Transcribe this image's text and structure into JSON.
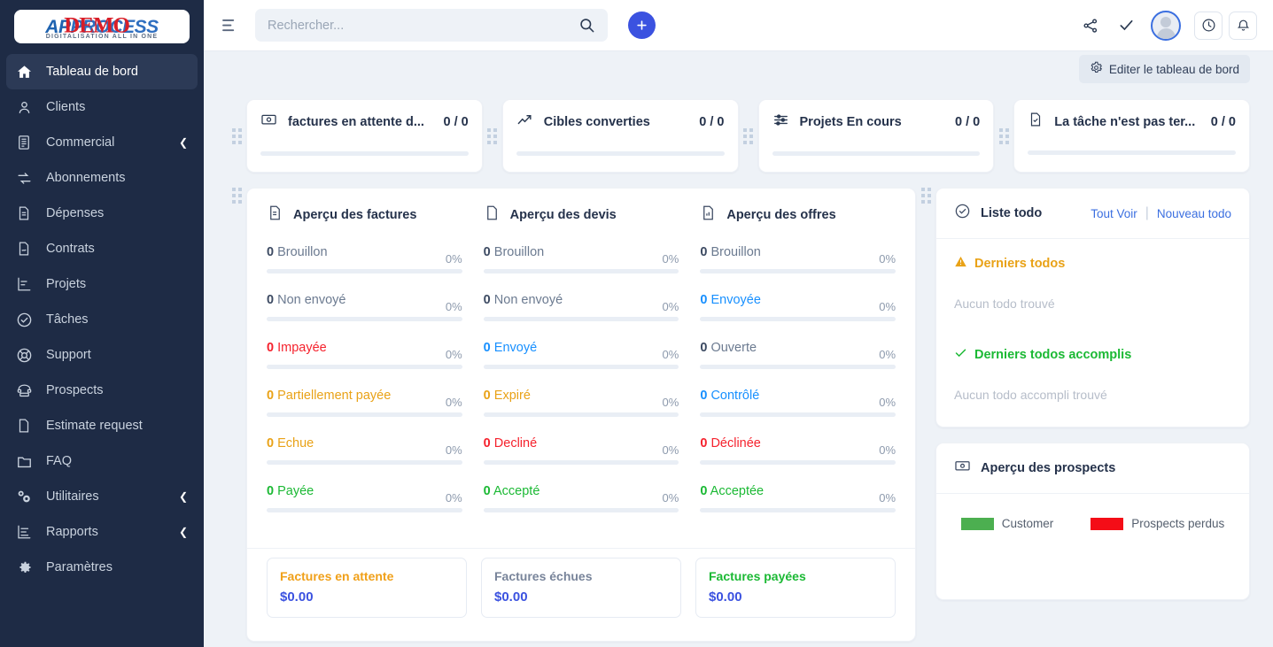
{
  "brand": {
    "logo_ap": "AP",
    "logo_process": "PROCESS",
    "logo_tagline": "DIGITALISATION ALL IN ONE",
    "logo_demo": "DEMO",
    "accent_blue": "#3b52e0",
    "navy": "#1e2b45"
  },
  "sidebar": {
    "items": [
      {
        "label": "Tableau de bord",
        "icon": "home-icon",
        "active": true,
        "caret": false
      },
      {
        "label": "Clients",
        "icon": "user-icon",
        "active": false,
        "caret": false
      },
      {
        "label": "Commercial",
        "icon": "receipt-icon",
        "active": false,
        "caret": true
      },
      {
        "label": "Abonnements",
        "icon": "refresh-icon",
        "active": false,
        "caret": false
      },
      {
        "label": "Dépenses",
        "icon": "document-icon",
        "active": false,
        "caret": false
      },
      {
        "label": "Contrats",
        "icon": "contract-icon",
        "active": false,
        "caret": false
      },
      {
        "label": "Projets",
        "icon": "chart-bar-icon",
        "active": false,
        "caret": false
      },
      {
        "label": "Tâches",
        "icon": "check-circle-icon",
        "active": false,
        "caret": false
      },
      {
        "label": "Support",
        "icon": "lifebuoy-icon",
        "active": false,
        "caret": false
      },
      {
        "label": "Prospects",
        "icon": "phone-icon",
        "active": false,
        "caret": false
      },
      {
        "label": "Estimate request",
        "icon": "file-icon",
        "active": false,
        "caret": false
      },
      {
        "label": "FAQ",
        "icon": "folder-icon",
        "active": false,
        "caret": false
      },
      {
        "label": "Utilitaires",
        "icon": "gears-icon",
        "active": false,
        "caret": true
      },
      {
        "label": "Rapports",
        "icon": "report-icon",
        "active": false,
        "caret": true
      },
      {
        "label": "Paramètres",
        "icon": "gear-icon",
        "active": false,
        "caret": false
      }
    ],
    "caret_glyph": "❮"
  },
  "topbar": {
    "search_placeholder": "Rechercher...",
    "search_value": "",
    "add_label": "+"
  },
  "edit_dashboard": {
    "label": "Editer le tableau de bord"
  },
  "stats": [
    {
      "title": "factures en attente d...",
      "value": "0 / 0",
      "icon": "invoice-icon"
    },
    {
      "title": "Cibles converties",
      "value": "0 / 0",
      "icon": "trending-up-icon"
    },
    {
      "title": "Projets En cours",
      "value": "0 / 0",
      "icon": "sliders-icon"
    },
    {
      "title": "La tâche n'est pas ter...",
      "value": "0 / 0",
      "icon": "task-doc-icon"
    }
  ],
  "overview": {
    "columns": [
      {
        "title": "Aperçu des factures",
        "icon": "invoice-doc-icon",
        "rows": [
          {
            "count": "0",
            "label": "Brouillon",
            "pct": "0%",
            "color": "gray"
          },
          {
            "count": "0",
            "label": "Non envoyé",
            "pct": "0%",
            "color": "gray"
          },
          {
            "count": "0",
            "label": "Impayée",
            "pct": "0%",
            "color": "red"
          },
          {
            "count": "0",
            "label": "Partiellement payée",
            "pct": "0%",
            "color": "orange"
          },
          {
            "count": "0",
            "label": "Echue",
            "pct": "0%",
            "color": "orange"
          },
          {
            "count": "0",
            "label": "Payée",
            "pct": "0%",
            "color": "green"
          }
        ]
      },
      {
        "title": "Aperçu des devis",
        "icon": "quote-doc-icon",
        "rows": [
          {
            "count": "0",
            "label": "Brouillon",
            "pct": "0%",
            "color": "gray"
          },
          {
            "count": "0",
            "label": "Non envoyé",
            "pct": "0%",
            "color": "gray"
          },
          {
            "count": "0",
            "label": "Envoyé",
            "pct": "0%",
            "color": "blue"
          },
          {
            "count": "0",
            "label": "Expiré",
            "pct": "0%",
            "color": "orange"
          },
          {
            "count": "0",
            "label": "Decliné",
            "pct": "0%",
            "color": "red"
          },
          {
            "count": "0",
            "label": "Accepté",
            "pct": "0%",
            "color": "green"
          }
        ]
      },
      {
        "title": "Aperçu des offres",
        "icon": "offer-doc-icon",
        "rows": [
          {
            "count": "0",
            "label": "Brouillon",
            "pct": "0%",
            "color": "gray"
          },
          {
            "count": "0",
            "label": "Envoyée",
            "pct": "0%",
            "color": "blue"
          },
          {
            "count": "0",
            "label": "Ouverte",
            "pct": "0%",
            "color": "gray"
          },
          {
            "count": "0",
            "label": "Contrôlé",
            "pct": "0%",
            "color": "blue"
          },
          {
            "count": "0",
            "label": "Déclinée",
            "pct": "0%",
            "color": "red"
          },
          {
            "count": "0",
            "label": "Acceptée",
            "pct": "0%",
            "color": "green"
          }
        ]
      }
    ],
    "amounts": [
      {
        "label": "Factures en attente",
        "value": "$0.00",
        "color": "#f0a019"
      },
      {
        "label": "Factures échues",
        "value": "$0.00",
        "color": "#78849a"
      },
      {
        "label": "Factures payées",
        "value": "$0.00",
        "color": "#1bb934"
      }
    ]
  },
  "todo": {
    "title": "Liste todo",
    "icon": "check-badge-icon",
    "view_all": "Tout Voir",
    "separator": "|",
    "new_todo": "Nouveau todo",
    "latest_title": "Derniers todos",
    "latest_empty": "Aucun todo trouvé",
    "done_title": "Derniers todos accomplis",
    "done_empty": "Aucun todo accompli trouvé",
    "warn_color": "#e9a217",
    "done_color": "#1bb934"
  },
  "prospects": {
    "title": "Aperçu des prospects",
    "icon": "money-icon",
    "legend": [
      {
        "label": "Customer",
        "color": "#4caf50"
      },
      {
        "label": "Prospects perdus",
        "color": "#f40d17"
      }
    ]
  }
}
